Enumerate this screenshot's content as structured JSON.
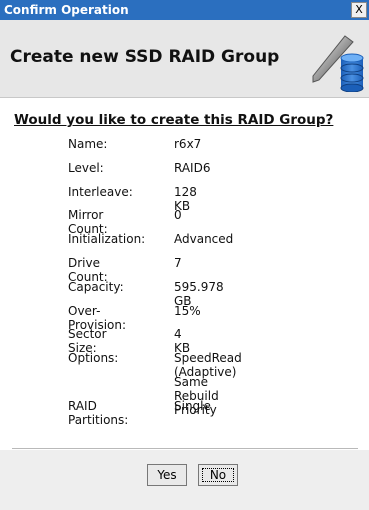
{
  "window": {
    "title": "Confirm Operation",
    "close_label": "X"
  },
  "header": {
    "heading": "Create new SSD RAID Group",
    "icon": "ssd-raid-icon"
  },
  "question": "Would you like to create this RAID Group?",
  "details": [
    {
      "label": "Name:",
      "value": "r6x7"
    },
    {
      "label": "Level:",
      "value": "RAID6"
    },
    {
      "label": "Interleave:",
      "value": "128 KB"
    },
    {
      "label": "Mirror Count:",
      "value": "0"
    },
    {
      "label": "Initialization:",
      "value": "Advanced"
    },
    {
      "label": "Drive Count:",
      "value": "7"
    },
    {
      "label": "Capacity:",
      "value": "595.978 GB"
    },
    {
      "label": "Over-Provision:",
      "value": "15%"
    },
    {
      "label": "Sector Size:",
      "value": "4 KB"
    },
    {
      "label": "Options:",
      "value": "SpeedRead (Adaptive)"
    },
    {
      "label": "",
      "value": "Same Rebuild Priority"
    },
    {
      "label": "RAID Partitions:",
      "value": "Single"
    }
  ],
  "buttons": {
    "yes": "Yes",
    "no": "No"
  }
}
